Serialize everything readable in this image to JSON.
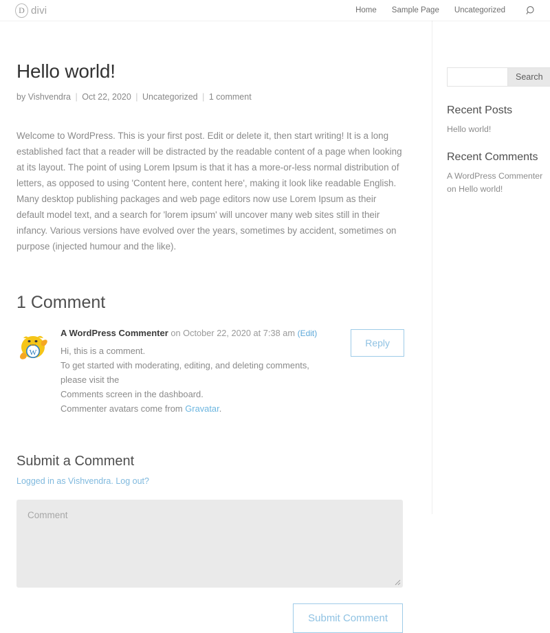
{
  "header": {
    "logo": {
      "mark": "D",
      "wordmark": "divi"
    },
    "nav": [
      {
        "label": "Home"
      },
      {
        "label": "Sample Page"
      },
      {
        "label": "Uncategorized"
      }
    ],
    "search_icon": "search-icon"
  },
  "post": {
    "title": "Hello world!",
    "meta": {
      "by_label": "by",
      "author": "Vishvendra",
      "date": "Oct 22, 2020",
      "category": "Uncategorized",
      "comment_count": "1 comment",
      "separator": "|"
    },
    "body": "Welcome to WordPress. This is your first post. Edit or delete it, then start writing! It is a long established fact that a reader will be distracted by the readable content of a page when looking at its layout. The point of using Lorem Ipsum is that it has a more-or-less normal distribution of letters, as opposed to using 'Content here, content here', making it look like readable English. Many desktop publishing packages and web page editors now use Lorem Ipsum as their default model text, and a search for 'lorem ipsum' will uncover many web sites still in their infancy. Various versions have evolved over the years, sometimes by accident, sometimes on purpose (injected humour and the like)."
  },
  "comments": {
    "heading": "1 Comment",
    "items": [
      {
        "author": "A WordPress Commenter",
        "meta": "on October 22, 2020 at 7:38 am",
        "edit_label": "(Edit)",
        "avatar_name": "wapuu-avatar",
        "lines": [
          "Hi, this is a comment.",
          "To get started with moderating, editing, and deleting comments, please visit the",
          "Comments screen in the dashboard."
        ],
        "avatar_note_prefix": "Commenter avatars come from ",
        "avatar_note_link": "Gravatar",
        "avatar_note_suffix": ".",
        "reply_label": "Reply"
      }
    ]
  },
  "comment_form": {
    "title": "Submit a Comment",
    "logged_in_prefix": "Logged in as Vishvendra. ",
    "logout_label": "Log out?",
    "textarea_placeholder": "Comment",
    "textarea_value": "",
    "submit_label": "Submit Comment"
  },
  "sidebar": {
    "search": {
      "placeholder": "",
      "value": "",
      "button_label": "Search"
    },
    "widgets": [
      {
        "title": "Recent Posts",
        "items": [
          "Hello world!"
        ]
      },
      {
        "title": "Recent Comments",
        "items": [
          "A WordPress Commenter",
          "on Hello world!"
        ]
      }
    ]
  },
  "colors": {
    "accent": "#7fb9de",
    "button_border": "#9ecbe8",
    "text_body": "#8a8a8a",
    "heading": "#4e4e4e",
    "textarea_bg": "#eaeaea"
  }
}
